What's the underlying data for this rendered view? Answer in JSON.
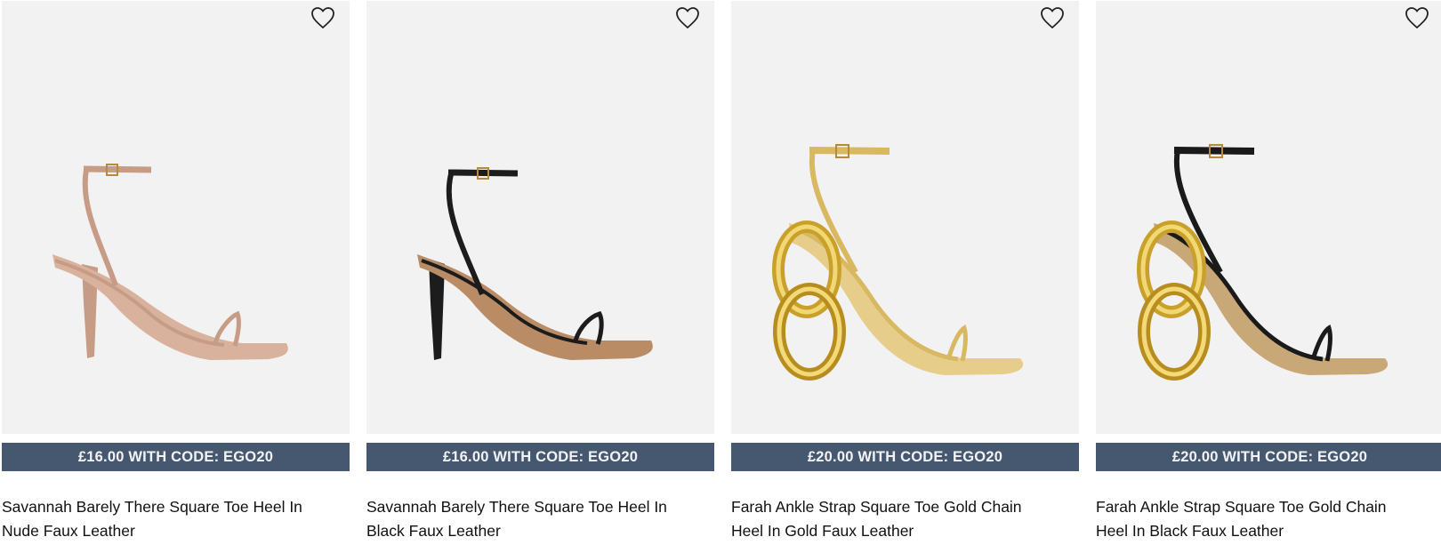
{
  "products": [
    {
      "promo": "£16.00 WITH CODE: EGO20",
      "name_line1": "Savannah Barely There Square Toe Heel In",
      "name_line2": "Nude Faux Leather",
      "strap_color": "#c69c86",
      "sole_color": "#d8b29c",
      "heel_style": "stiletto"
    },
    {
      "promo": "£16.00 WITH CODE: EGO20",
      "name_line1": "Savannah Barely There Square Toe Heel In",
      "name_line2": "Black Faux Leather",
      "strap_color": "#1c1c1c",
      "sole_color": "#b98c66",
      "heel_style": "stiletto"
    },
    {
      "promo": "£20.00 WITH CODE: EGO20",
      "name_line1": "Farah Ankle Strap Square Toe Gold Chain",
      "name_line2": "Heel In Gold Faux Leather",
      "strap_color": "#d8b860",
      "sole_color": "#e7cd8a",
      "heel_style": "gold-chain"
    },
    {
      "promo": "£20.00 WITH CODE: EGO20",
      "name_line1": "Farah Ankle Strap Square Toe Gold Chain",
      "name_line2": "Heel In Black Faux Leather",
      "strap_color": "#1a1a1a",
      "sole_color": "#c9a878",
      "heel_style": "gold-chain"
    }
  ],
  "icons": {
    "wishlist": "heart-outline-icon"
  },
  "colors": {
    "promo_bg": "#465770",
    "image_bg": "#f2f2f2",
    "gold": "#d7a935"
  }
}
